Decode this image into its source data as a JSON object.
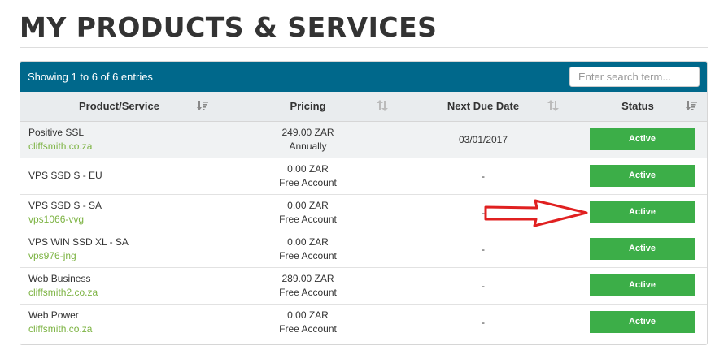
{
  "page": {
    "title": "MY PRODUCTS & SERVICES"
  },
  "panel": {
    "entries_info": "Showing 1 to 6 of 6 entries",
    "search_placeholder": "Enter search term..."
  },
  "columns": {
    "product": "Product/Service",
    "pricing": "Pricing",
    "due": "Next Due Date",
    "status": "Status"
  },
  "rows": [
    {
      "name": "Positive SSL",
      "domain": "cliffsmith.co.za",
      "amount": "249.00 ZAR",
      "cycle": "Annually",
      "due": "03/01/2017",
      "status": "Active"
    },
    {
      "name": "VPS SSD S - EU",
      "domain": "",
      "amount": "0.00 ZAR",
      "cycle": "Free Account",
      "due": "-",
      "status": "Active"
    },
    {
      "name": "VPS SSD S - SA",
      "domain": "vps1066-vvg",
      "amount": "0.00 ZAR",
      "cycle": "Free Account",
      "due": "-",
      "status": "Active"
    },
    {
      "name": "VPS WIN SSD XL - SA",
      "domain": "vps976-jng",
      "amount": "0.00 ZAR",
      "cycle": "Free Account",
      "due": "-",
      "status": "Active"
    },
    {
      "name": "Web Business",
      "domain": "cliffsmith2.co.za",
      "amount": "289.00 ZAR",
      "cycle": "Free Account",
      "due": "-",
      "status": "Active"
    },
    {
      "name": "Web Power",
      "domain": "cliffsmith.co.za",
      "amount": "0.00 ZAR",
      "cycle": "Free Account",
      "due": "-",
      "status": "Active"
    }
  ],
  "colors": {
    "header": "#00688b",
    "status_active": "#3cae48",
    "domain_link": "#7cb342",
    "arrow": "#e02020"
  },
  "icons": {
    "sort_active": "sort-amount-down-icon",
    "sort_inactive": "sort-icon",
    "annotation": "red-arrow-icon"
  }
}
